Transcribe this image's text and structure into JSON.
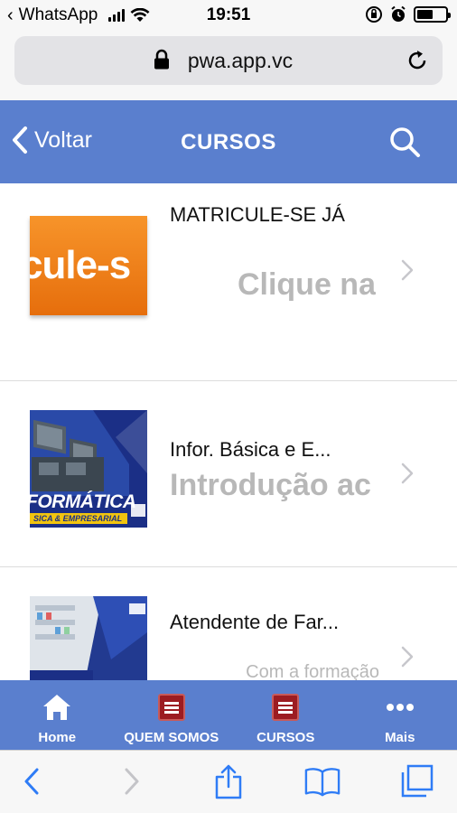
{
  "status_bar": {
    "back_app": "WhatsApp",
    "time": "19:51"
  },
  "browser": {
    "url": "pwa.app.vc"
  },
  "header": {
    "back_label": "Voltar",
    "title": "CURSOS"
  },
  "courses": [
    {
      "title": "MATRICULE-SE JÁ",
      "subtitle": "Clique na",
      "thumb_text": "cule-s"
    },
    {
      "title": "Infor. Básica e E...",
      "subtitle": "Introdução ac",
      "thumb_text": "FORMÁTICA",
      "thumb_subtext": "SICA & EMPRESARIAL"
    },
    {
      "title": "Atendente de Far...",
      "subtitle": "Com a formação"
    }
  ],
  "tabs": [
    {
      "label": "Home",
      "icon": "home-icon"
    },
    {
      "label": "QUEM SOMOS",
      "icon": "book-badge-icon"
    },
    {
      "label": "CURSOS",
      "icon": "book-badge-icon"
    },
    {
      "label": "Mais",
      "icon": "more-icon"
    }
  ],
  "colors": {
    "app_blue": "#5a7fce",
    "subtitle_gray": "#b8b8b8",
    "badge_red": "#9c1c22"
  }
}
